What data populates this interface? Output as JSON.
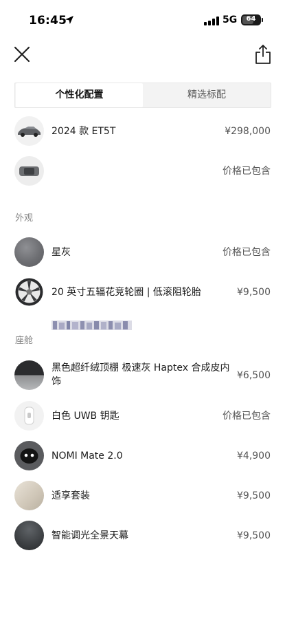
{
  "status_bar": {
    "time": "16:45",
    "network": "5G",
    "battery": "64",
    "battery_percent": 64
  },
  "nav": {
    "close_icon": "close-icon",
    "share_icon": "share-icon"
  },
  "tabs": [
    {
      "label": "个性化配置",
      "active": true
    },
    {
      "label": "精选标配",
      "active": false
    }
  ],
  "items": {
    "model": {
      "label": "2024 款 ET5T",
      "price": "¥298,000"
    },
    "color_pkg": {
      "price": "价格已包含"
    }
  },
  "sections": {
    "exterior": {
      "title": "外观",
      "items": [
        {
          "label": "星灰",
          "price": "价格已包含"
        },
        {
          "label": "20 英寸五辐花竞轮圈 | 低滚阻轮胎",
          "price": "¥9,500"
        }
      ]
    },
    "cabin": {
      "title": "座舱",
      "items": [
        {
          "label": "黑色超纤绒顶棚 极速灰 Haptex 合成皮内饰",
          "price": "¥6,500"
        },
        {
          "label": "白色 UWB 钥匙",
          "price": "价格已包含"
        },
        {
          "label": "NOMI Mate 2.0",
          "price": "¥4,900"
        },
        {
          "label": "适享套装",
          "price": "¥9,500"
        },
        {
          "label": "智能调光全景天幕",
          "price": "¥9,500"
        }
      ]
    }
  }
}
